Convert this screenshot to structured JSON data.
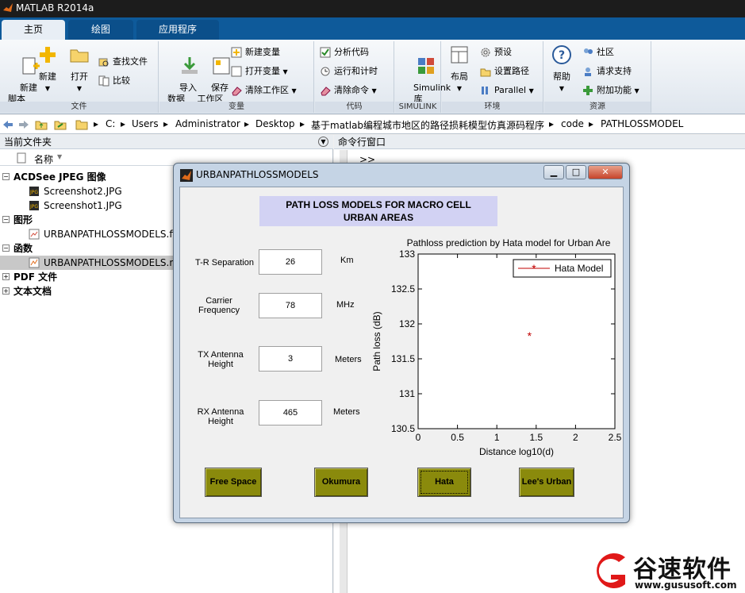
{
  "app": {
    "title": "MATLAB R2014a"
  },
  "tabs": [
    {
      "label": "主页"
    },
    {
      "label": "绘图"
    },
    {
      "label": "应用程序"
    }
  ],
  "ribbon": {
    "file": {
      "title": "文件",
      "new_script": "新建\n脚本",
      "new": "新建",
      "open": "打开",
      "find_files": "查找文件",
      "compare": "比较"
    },
    "variable": {
      "title": "变量",
      "import": "导入\n数据",
      "save_ws": "保存\n工作区",
      "new_var": "新建变量",
      "open_var": "打开变量",
      "clear_ws": "清除工作区"
    },
    "code": {
      "title": "代码",
      "analyze": "分析代码",
      "run_time": "运行和计时",
      "clear_cmd": "清除命令"
    },
    "simulink": {
      "title": "SIMULINK",
      "lib": "Simulink\n库"
    },
    "env": {
      "title": "环境",
      "layout": "布局",
      "prefs": "预设",
      "set_path": "设置路径",
      "parallel": "Parallel"
    },
    "resources": {
      "title": "资源",
      "help": "帮助",
      "community": "社区",
      "support": "请求支持",
      "addons": "附加功能"
    }
  },
  "address": {
    "crumbs": [
      "C:",
      "Users",
      "Administrator",
      "Desktop",
      "基于matlab编程城市地区的路径损耗模型仿真源码程序",
      "code",
      "PATHLOSSMODEL"
    ]
  },
  "current_folder": {
    "title": "当前文件夹",
    "col_name": "名称",
    "groups": [
      {
        "label": "ACDSee JPEG 图像",
        "items": [
          "Screenshot2.JPG",
          "Screenshot1.JPG"
        ]
      },
      {
        "label": "图形",
        "items": [
          "URBANPATHLOSSMODELS.fig"
        ]
      },
      {
        "label": "函数",
        "items": [
          "URBANPATHLOSSMODELS.m"
        ]
      },
      {
        "label": "PDF 文件",
        "items": []
      },
      {
        "label": "文本文档",
        "items": []
      }
    ]
  },
  "command_window": {
    "title": "命令行窗口",
    "prompt": ">>"
  },
  "figure": {
    "title": "URBANPATHLOSSMODELS",
    "heading_1": "PATH LOSS MODELS FOR MACRO CELL",
    "heading_2": "URBAN AREAS",
    "fields": [
      {
        "label": "T-R Separation",
        "value": "26",
        "unit": "Km"
      },
      {
        "label": "Carrier Frequency",
        "value": "78",
        "unit": "MHz"
      },
      {
        "label": "TX Antenna Height",
        "value": "3",
        "unit": "Meters"
      },
      {
        "label": "RX Antenna Height",
        "value": "465",
        "unit": "Meters"
      }
    ],
    "buttons": [
      "Free Space",
      "Okumura",
      "Hata",
      "Lee's Urban"
    ]
  },
  "chart_data": {
    "type": "scatter",
    "title": "Pathloss prediction by Hata model for Urban Are",
    "xlabel": "Distance log10(d)",
    "ylabel": "Path loss (dB)",
    "xlim": [
      0,
      2.5
    ],
    "ylim": [
      130.5,
      133
    ],
    "xticks": [
      "0",
      "0.5",
      "1",
      "1.5",
      "2",
      "2.5"
    ],
    "yticks": [
      "130.5",
      "131",
      "131.5",
      "132",
      "132.5",
      "133"
    ],
    "series": [
      {
        "name": "Hata Model",
        "x": [
          1.415
        ],
        "y": [
          131.83
        ],
        "color": "#c00000",
        "marker": "*"
      }
    ],
    "legend": "top-right",
    "grid": false
  },
  "watermark": {
    "brand": "谷速软件",
    "url": "www.gususoft.com"
  }
}
